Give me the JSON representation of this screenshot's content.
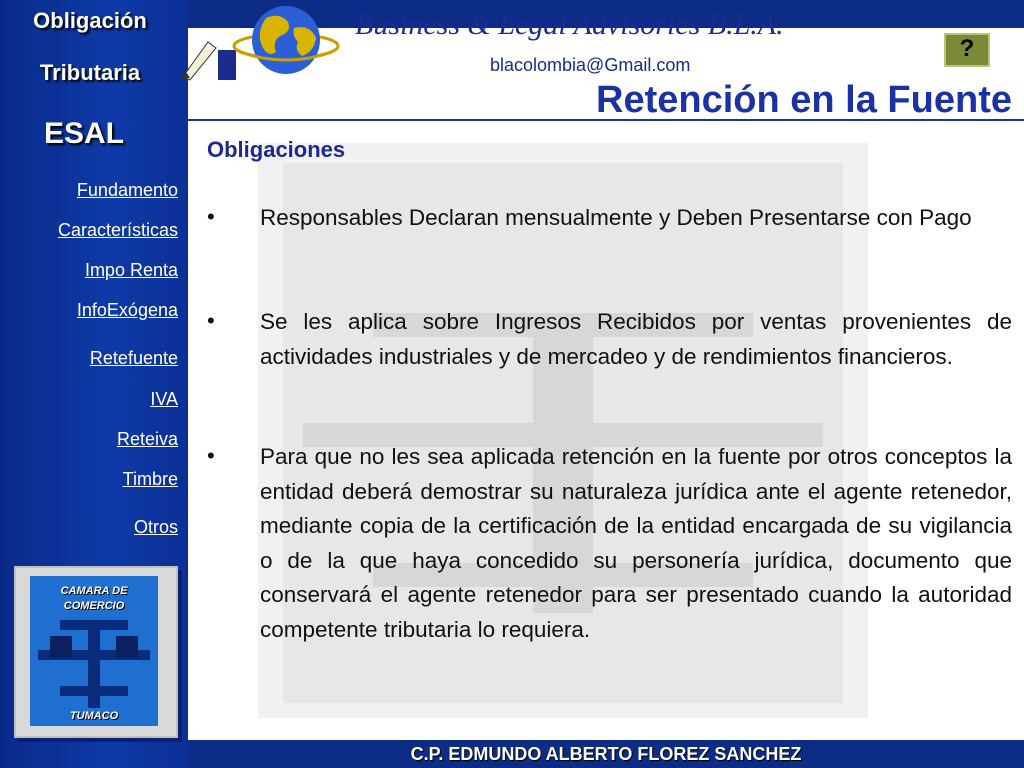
{
  "sidebar": {
    "title_line1": "Obligación",
    "title_line2": "Tributaria",
    "subtitle": "ESAL",
    "links": [
      "Fundamento",
      "Características",
      "Impo Renta",
      "InfoExógena",
      "Retefuente",
      "IVA",
      "Reteiva",
      "Timbre",
      "Otros"
    ],
    "logo_text_top": "CAMARA DE\nCOMERCIO",
    "logo_text_bottom": "TUMACO"
  },
  "header": {
    "brand": "Business & Legal Advisories B.L.A.",
    "email": "blacolombia@Gmail.com",
    "help_icon": "question-mark-icon",
    "title": "Retención en la Fuente"
  },
  "content": {
    "heading": "Obligaciones",
    "bullet_char": "•",
    "bullets": [
      "Responsables Declaran mensualmente y Deben Presentarse con Pago",
      "Se les aplica sobre Ingresos Recibidos por ventas provenientes de actividades industriales y de mercadeo y de rendimientos financieros.",
      "Para que no les sea aplicada retención en la fuente por otros conceptos la entidad deberá demostrar su naturaleza jurídica ante el agente retenedor, mediante copia de la certificación de la entidad encargada de su vigilancia o de la que haya concedido su personería jurídica, documento que conservará el agente retenedor para ser presentado cuando la autoridad competente tributaria lo requiera."
    ]
  },
  "footer": {
    "author": "C.P. EDMUNDO ALBERTO FLOREZ SANCHEZ"
  },
  "colors": {
    "background": "#0d2c86",
    "title_blue": "#1a32a4",
    "help_button": "#7a8a36"
  }
}
